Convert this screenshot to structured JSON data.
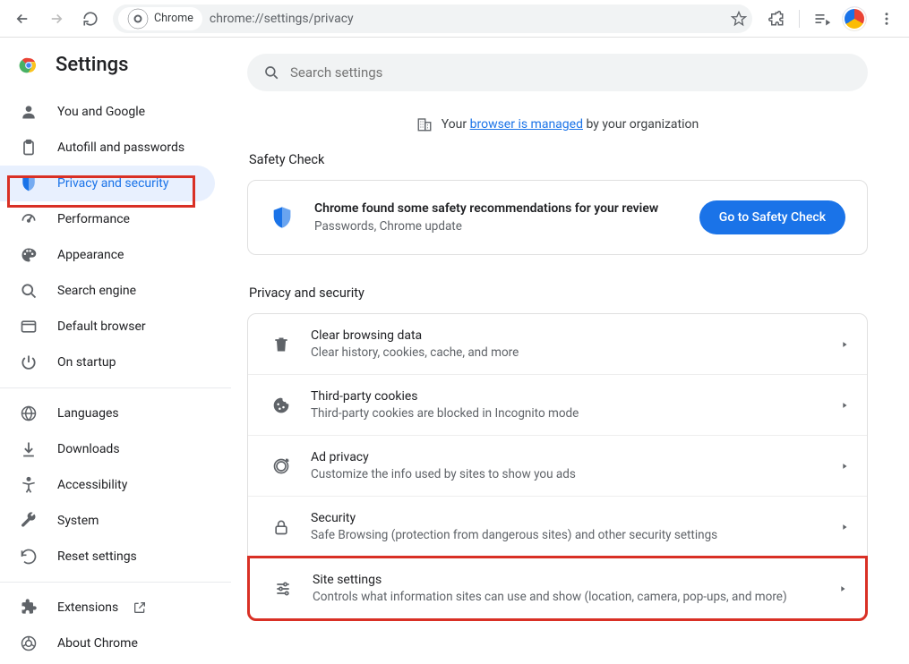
{
  "toolbar": {
    "chip_label": "Chrome",
    "url": "chrome://settings/privacy"
  },
  "brand": {
    "title": "Settings"
  },
  "search": {
    "placeholder": "Search settings"
  },
  "managed": {
    "prefix": "Your ",
    "link": "browser is managed",
    "suffix": " by your organization"
  },
  "sections": {
    "safety_label": "Safety Check",
    "privacy_label": "Privacy and security"
  },
  "safety_card": {
    "title": "Chrome found some safety recommendations for your review",
    "subtitle": "Passwords, Chrome update",
    "button": "Go to Safety Check"
  },
  "sidebar": {
    "items": [
      {
        "label": "You and Google"
      },
      {
        "label": "Autofill and passwords"
      },
      {
        "label": "Privacy and security"
      },
      {
        "label": "Performance"
      },
      {
        "label": "Appearance"
      },
      {
        "label": "Search engine"
      },
      {
        "label": "Default browser"
      },
      {
        "label": "On startup"
      }
    ],
    "items2": [
      {
        "label": "Languages"
      },
      {
        "label": "Downloads"
      },
      {
        "label": "Accessibility"
      },
      {
        "label": "System"
      },
      {
        "label": "Reset settings"
      }
    ],
    "items3": [
      {
        "label": "Extensions"
      },
      {
        "label": "About Chrome"
      }
    ]
  },
  "rows": [
    {
      "title": "Clear browsing data",
      "sub": "Clear history, cookies, cache, and more"
    },
    {
      "title": "Third-party cookies",
      "sub": "Third-party cookies are blocked in Incognito mode"
    },
    {
      "title": "Ad privacy",
      "sub": "Customize the info used by sites to show you ads"
    },
    {
      "title": "Security",
      "sub": "Safe Browsing (protection from dangerous sites) and other security settings"
    },
    {
      "title": "Site settings",
      "sub": "Controls what information sites can use and show (location, camera, pop-ups, and more)"
    }
  ]
}
